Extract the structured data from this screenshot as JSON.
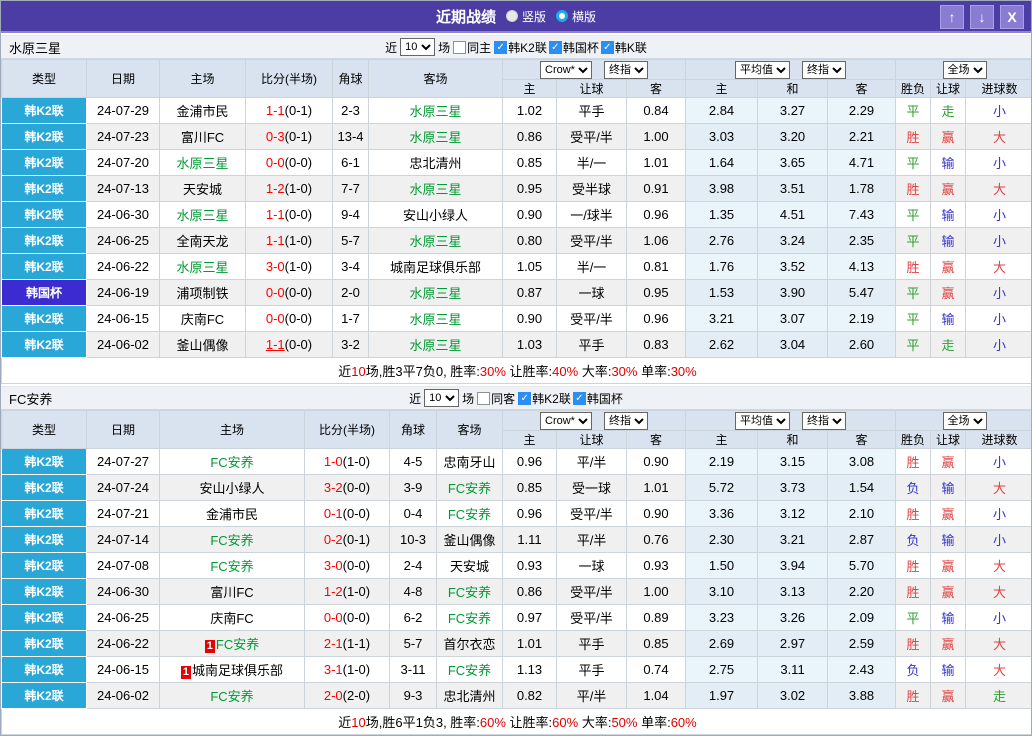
{
  "title_bar": {
    "title": "近期战绩",
    "radios": [
      {
        "label": "竖版",
        "selected": false
      },
      {
        "label": "横版",
        "selected": true
      }
    ],
    "buttons": {
      "up": "↑",
      "down": "↓",
      "close": "X"
    }
  },
  "columns": {
    "type": "类型",
    "date": "日期",
    "home": "主场",
    "score": "比分(半场)",
    "corner": "角球",
    "away": "客场",
    "host": "主",
    "handicap": "让球",
    "guest": "客",
    "avg_host": "主",
    "draw": "和",
    "avg_guest": "客",
    "result": "胜负",
    "handicap2": "让球",
    "goals": "进球数"
  },
  "selects": {
    "bookmaker": "Crow*",
    "final": "终指",
    "average": "平均值",
    "final2": "终指",
    "scope": "全场"
  },
  "controls_labels": {
    "near": "近",
    "games": "场"
  },
  "sections": [
    {
      "name": "水原三星",
      "count": "10",
      "same_label": "同主",
      "same_checked": false,
      "leagues": [
        {
          "label": "韩K2联",
          "checked": true
        },
        {
          "label": "韩国杯",
          "checked": true
        },
        {
          "label": "韩K联",
          "checked": true
        }
      ],
      "rows": [
        {
          "league": "韩K2联",
          "cup": false,
          "date": "24-07-29",
          "home": "金浦市民",
          "homeSelf": false,
          "badge": "",
          "score": "1-1",
          "half": "(0-1)",
          "u": false,
          "corner": "2-3",
          "away": "水原三星",
          "awaySelf": true,
          "o": [
            "1.02",
            "平手",
            "0.84"
          ],
          "avg": [
            "2.84",
            "3.27",
            "2.29"
          ],
          "res": [
            "平",
            "g"
          ],
          "let": [
            "走",
            "g"
          ],
          "goal": [
            "小",
            "b"
          ]
        },
        {
          "league": "韩K2联",
          "cup": false,
          "date": "24-07-23",
          "home": "富川FC",
          "homeSelf": false,
          "badge": "",
          "score": "0-3",
          "half": "(0-1)",
          "u": false,
          "corner": "13-4",
          "away": "水原三星",
          "awaySelf": true,
          "o": [
            "0.86",
            "受平/半",
            "1.00"
          ],
          "avg": [
            "3.03",
            "3.20",
            "2.21"
          ],
          "res": [
            "胜",
            "r"
          ],
          "let": [
            "赢",
            "r"
          ],
          "goal": [
            "大",
            "r"
          ]
        },
        {
          "league": "韩K2联",
          "cup": false,
          "date": "24-07-20",
          "home": "水原三星",
          "homeSelf": true,
          "badge": "",
          "score": "0-0",
          "half": "(0-0)",
          "u": false,
          "corner": "6-1",
          "away": "忠北清州",
          "awaySelf": false,
          "o": [
            "0.85",
            "半/一",
            "1.01"
          ],
          "avg": [
            "1.64",
            "3.65",
            "4.71"
          ],
          "res": [
            "平",
            "g"
          ],
          "let": [
            "输",
            "b"
          ],
          "goal": [
            "小",
            "b"
          ]
        },
        {
          "league": "韩K2联",
          "cup": false,
          "date": "24-07-13",
          "home": "天安城",
          "homeSelf": false,
          "badge": "",
          "score": "1-2",
          "half": "(1-0)",
          "u": false,
          "corner": "7-7",
          "away": "水原三星",
          "awaySelf": true,
          "o": [
            "0.95",
            "受半球",
            "0.91"
          ],
          "avg": [
            "3.98",
            "3.51",
            "1.78"
          ],
          "res": [
            "胜",
            "r"
          ],
          "let": [
            "赢",
            "r"
          ],
          "goal": [
            "大",
            "r"
          ]
        },
        {
          "league": "韩K2联",
          "cup": false,
          "date": "24-06-30",
          "home": "水原三星",
          "homeSelf": true,
          "badge": "",
          "score": "1-1",
          "half": "(0-0)",
          "u": false,
          "corner": "9-4",
          "away": "安山小绿人",
          "awaySelf": false,
          "o": [
            "0.90",
            "一/球半",
            "0.96"
          ],
          "avg": [
            "1.35",
            "4.51",
            "7.43"
          ],
          "res": [
            "平",
            "g"
          ],
          "let": [
            "输",
            "b"
          ],
          "goal": [
            "小",
            "b"
          ]
        },
        {
          "league": "韩K2联",
          "cup": false,
          "date": "24-06-25",
          "home": "全南天龙",
          "homeSelf": false,
          "badge": "",
          "score": "1-1",
          "half": "(1-0)",
          "u": false,
          "corner": "5-7",
          "away": "水原三星",
          "awaySelf": true,
          "o": [
            "0.80",
            "受平/半",
            "1.06"
          ],
          "avg": [
            "2.76",
            "3.24",
            "2.35"
          ],
          "res": [
            "平",
            "g"
          ],
          "let": [
            "输",
            "b"
          ],
          "goal": [
            "小",
            "b"
          ]
        },
        {
          "league": "韩K2联",
          "cup": false,
          "date": "24-06-22",
          "home": "水原三星",
          "homeSelf": true,
          "badge": "",
          "score": "3-0",
          "half": "(1-0)",
          "u": false,
          "corner": "3-4",
          "away": "城南足球俱乐部",
          "awaySelf": false,
          "o": [
            "1.05",
            "半/一",
            "0.81"
          ],
          "avg": [
            "1.76",
            "3.52",
            "4.13"
          ],
          "res": [
            "胜",
            "r"
          ],
          "let": [
            "赢",
            "r"
          ],
          "goal": [
            "大",
            "r"
          ]
        },
        {
          "league": "韩国杯",
          "cup": true,
          "date": "24-06-19",
          "home": "浦项制铁",
          "homeSelf": false,
          "badge": "",
          "score": "0-0",
          "half": "(0-0)",
          "u": false,
          "corner": "2-0",
          "away": "水原三星",
          "awaySelf": true,
          "o": [
            "0.87",
            "一球",
            "0.95"
          ],
          "avg": [
            "1.53",
            "3.90",
            "5.47"
          ],
          "res": [
            "平",
            "g"
          ],
          "let": [
            "赢",
            "r"
          ],
          "goal": [
            "小",
            "b"
          ]
        },
        {
          "league": "韩K2联",
          "cup": false,
          "date": "24-06-15",
          "home": "庆南FC",
          "homeSelf": false,
          "badge": "",
          "score": "0-0",
          "half": "(0-0)",
          "u": false,
          "corner": "1-7",
          "away": "水原三星",
          "awaySelf": true,
          "o": [
            "0.90",
            "受平/半",
            "0.96"
          ],
          "avg": [
            "3.21",
            "3.07",
            "2.19"
          ],
          "res": [
            "平",
            "g"
          ],
          "let": [
            "输",
            "b"
          ],
          "goal": [
            "小",
            "b"
          ]
        },
        {
          "league": "韩K2联",
          "cup": false,
          "date": "24-06-02",
          "home": "釜山偶像",
          "homeSelf": false,
          "badge": "",
          "score": "1-1",
          "half": "(0-0)",
          "u": true,
          "corner": "3-2",
          "away": "水原三星",
          "awaySelf": true,
          "o": [
            "1.03",
            "平手",
            "0.83"
          ],
          "avg": [
            "2.62",
            "3.04",
            "2.60"
          ],
          "res": [
            "平",
            "g"
          ],
          "let": [
            "走",
            "g"
          ],
          "goal": [
            "小",
            "b"
          ]
        }
      ],
      "summary": [
        {
          "t": "近",
          "r": false
        },
        {
          "t": "10",
          "r": true
        },
        {
          "t": "场,胜3平7负0, 胜率:",
          "r": false
        },
        {
          "t": "30%",
          "r": true
        },
        {
          "t": " 让胜率:",
          "r": false
        },
        {
          "t": "40%",
          "r": true
        },
        {
          "t": " 大率:",
          "r": false
        },
        {
          "t": "30%",
          "r": true
        },
        {
          "t": " 单率:",
          "r": false
        },
        {
          "t": "30%",
          "r": true
        }
      ]
    },
    {
      "name": "FC安养",
      "count": "10",
      "same_label": "同客",
      "same_checked": false,
      "leagues": [
        {
          "label": "韩K2联",
          "checked": true
        },
        {
          "label": "韩国杯",
          "checked": true
        }
      ],
      "rows": [
        {
          "league": "韩K2联",
          "cup": false,
          "date": "24-07-27",
          "home": "FC安养",
          "homeSelf": true,
          "badge": "",
          "score": "1-0",
          "half": "(1-0)",
          "u": false,
          "corner": "4-5",
          "away": "忠南牙山",
          "awaySelf": false,
          "o": [
            "0.96",
            "平/半",
            "0.90"
          ],
          "avg": [
            "2.19",
            "3.15",
            "3.08"
          ],
          "res": [
            "胜",
            "r"
          ],
          "let": [
            "赢",
            "r"
          ],
          "goal": [
            "小",
            "b"
          ]
        },
        {
          "league": "韩K2联",
          "cup": false,
          "date": "24-07-24",
          "home": "安山小绿人",
          "homeSelf": false,
          "badge": "",
          "score": "3-2",
          "half": "(0-0)",
          "u": false,
          "corner": "3-9",
          "away": "FC安养",
          "awaySelf": true,
          "o": [
            "0.85",
            "受一球",
            "1.01"
          ],
          "avg": [
            "5.72",
            "3.73",
            "1.54"
          ],
          "res": [
            "负",
            "b"
          ],
          "let": [
            "输",
            "b"
          ],
          "goal": [
            "大",
            "r"
          ]
        },
        {
          "league": "韩K2联",
          "cup": false,
          "date": "24-07-21",
          "home": "金浦市民",
          "homeSelf": false,
          "badge": "",
          "score": "0-1",
          "half": "(0-0)",
          "u": false,
          "corner": "0-4",
          "away": "FC安养",
          "awaySelf": true,
          "o": [
            "0.96",
            "受平/半",
            "0.90"
          ],
          "avg": [
            "3.36",
            "3.12",
            "2.10"
          ],
          "res": [
            "胜",
            "r"
          ],
          "let": [
            "赢",
            "r"
          ],
          "goal": [
            "小",
            "b"
          ]
        },
        {
          "league": "韩K2联",
          "cup": false,
          "date": "24-07-14",
          "home": "FC安养",
          "homeSelf": true,
          "badge": "",
          "score": "0-2",
          "half": "(0-1)",
          "u": false,
          "corner": "10-3",
          "away": "釜山偶像",
          "awaySelf": false,
          "o": [
            "1.11",
            "平/半",
            "0.76"
          ],
          "avg": [
            "2.30",
            "3.21",
            "2.87"
          ],
          "res": [
            "负",
            "b"
          ],
          "let": [
            "输",
            "b"
          ],
          "goal": [
            "小",
            "b"
          ]
        },
        {
          "league": "韩K2联",
          "cup": false,
          "date": "24-07-08",
          "home": "FC安养",
          "homeSelf": true,
          "badge": "",
          "score": "3-0",
          "half": "(0-0)",
          "u": false,
          "corner": "2-4",
          "away": "天安城",
          "awaySelf": false,
          "o": [
            "0.93",
            "一球",
            "0.93"
          ],
          "avg": [
            "1.50",
            "3.94",
            "5.70"
          ],
          "res": [
            "胜",
            "r"
          ],
          "let": [
            "赢",
            "r"
          ],
          "goal": [
            "大",
            "r"
          ]
        },
        {
          "league": "韩K2联",
          "cup": false,
          "date": "24-06-30",
          "home": "富川FC",
          "homeSelf": false,
          "badge": "",
          "score": "1-2",
          "half": "(1-0)",
          "u": false,
          "corner": "4-8",
          "away": "FC安养",
          "awaySelf": true,
          "o": [
            "0.86",
            "受平/半",
            "1.00"
          ],
          "avg": [
            "3.10",
            "3.13",
            "2.20"
          ],
          "res": [
            "胜",
            "r"
          ],
          "let": [
            "赢",
            "r"
          ],
          "goal": [
            "大",
            "r"
          ]
        },
        {
          "league": "韩K2联",
          "cup": false,
          "date": "24-06-25",
          "home": "庆南FC",
          "homeSelf": false,
          "badge": "",
          "score": "0-0",
          "half": "(0-0)",
          "u": false,
          "corner": "6-2",
          "away": "FC安养",
          "awaySelf": true,
          "o": [
            "0.97",
            "受平/半",
            "0.89"
          ],
          "avg": [
            "3.23",
            "3.26",
            "2.09"
          ],
          "res": [
            "平",
            "g"
          ],
          "let": [
            "输",
            "b"
          ],
          "goal": [
            "小",
            "b"
          ]
        },
        {
          "league": "韩K2联",
          "cup": false,
          "date": "24-06-22",
          "home": "FC安养",
          "homeSelf": true,
          "badge": "1",
          "score": "2-1",
          "half": "(1-1)",
          "u": false,
          "corner": "5-7",
          "away": "首尔衣恋",
          "awaySelf": false,
          "o": [
            "1.01",
            "平手",
            "0.85"
          ],
          "avg": [
            "2.69",
            "2.97",
            "2.59"
          ],
          "res": [
            "胜",
            "r"
          ],
          "let": [
            "赢",
            "r"
          ],
          "goal": [
            "大",
            "r"
          ]
        },
        {
          "league": "韩K2联",
          "cup": false,
          "date": "24-06-15",
          "home": "城南足球俱乐部",
          "homeSelf": false,
          "badge": "1",
          "score": "3-1",
          "half": "(1-0)",
          "u": false,
          "corner": "3-11",
          "away": "FC安养",
          "awaySelf": true,
          "o": [
            "1.13",
            "平手",
            "0.74"
          ],
          "avg": [
            "2.75",
            "3.11",
            "2.43"
          ],
          "res": [
            "负",
            "b"
          ],
          "let": [
            "输",
            "b"
          ],
          "goal": [
            "大",
            "r"
          ]
        },
        {
          "league": "韩K2联",
          "cup": false,
          "date": "24-06-02",
          "home": "FC安养",
          "homeSelf": true,
          "badge": "",
          "score": "2-0",
          "half": "(2-0)",
          "u": false,
          "corner": "9-3",
          "away": "忠北清州",
          "awaySelf": false,
          "o": [
            "0.82",
            "平/半",
            "1.04"
          ],
          "avg": [
            "1.97",
            "3.02",
            "3.88"
          ],
          "res": [
            "胜",
            "r"
          ],
          "let": [
            "赢",
            "r"
          ],
          "goal": [
            "走",
            "g"
          ]
        }
      ],
      "summary": [
        {
          "t": "近",
          "r": false
        },
        {
          "t": "10",
          "r": true
        },
        {
          "t": "场,胜6平1负3, 胜率:",
          "r": false
        },
        {
          "t": "60%",
          "r": true
        },
        {
          "t": " 让胜率:",
          "r": false
        },
        {
          "t": "60%",
          "r": true
        },
        {
          "t": " 大率:",
          "r": false
        },
        {
          "t": "50%",
          "r": true
        },
        {
          "t": " 单率:",
          "r": false
        },
        {
          "t": "60%",
          "r": true
        }
      ]
    }
  ],
  "colors": {
    "title_bar": "#4c3da5",
    "league_k2": "#29a8d8",
    "league_cup": "#3c2bd1",
    "tracked_team": "#009933",
    "score_red": "#ff0000",
    "win_red": "#e04444",
    "draw_green": "#2e9e2e",
    "lose_blue": "#3333cc",
    "checkbox_blue": "#2b8ef0"
  }
}
